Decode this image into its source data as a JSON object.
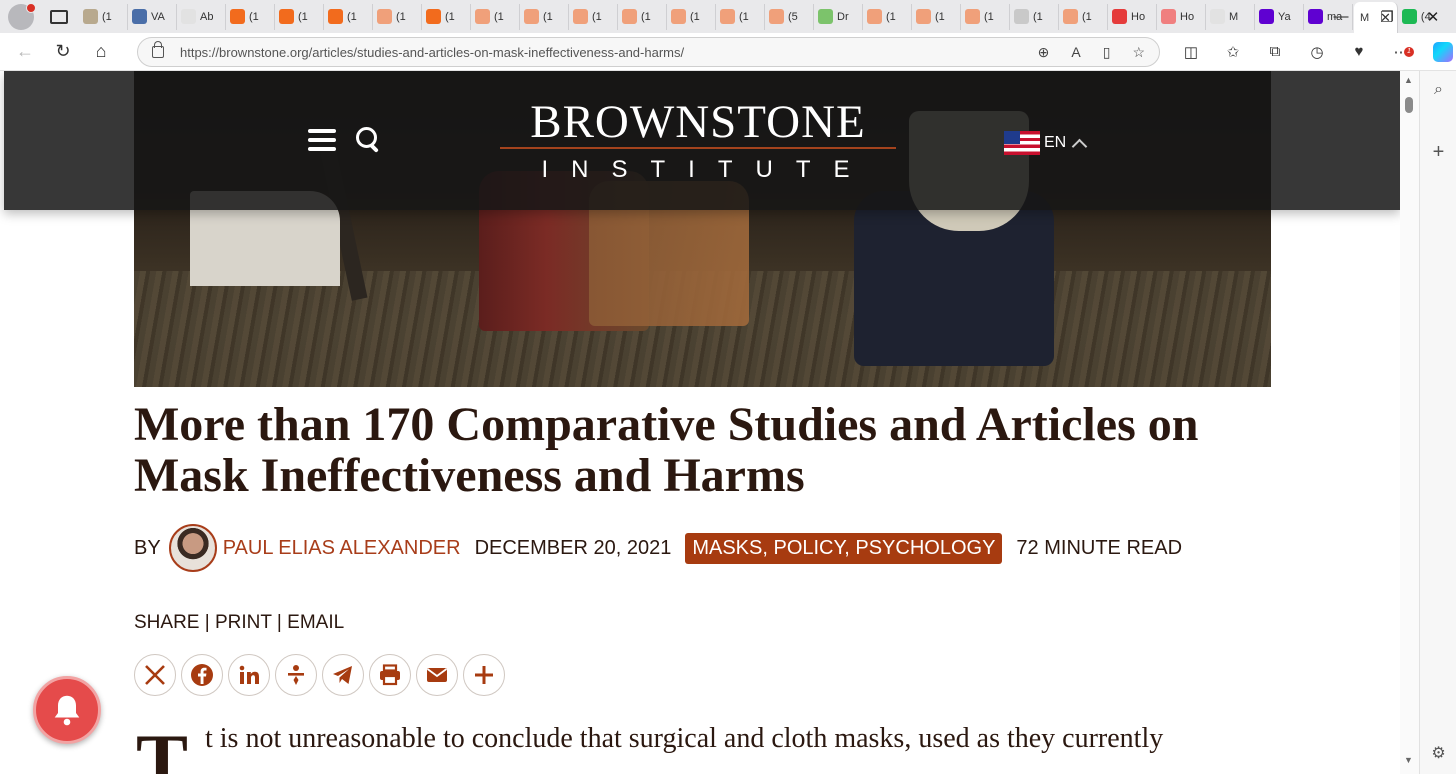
{
  "browser": {
    "tabs": [
      {
        "label": "(1",
        "color": "#b8a98e"
      },
      {
        "label": "VA",
        "color": "#4a6ea8"
      },
      {
        "label": "Ab",
        "color": "#e2e2e2"
      },
      {
        "label": "(1",
        "color": "#f26b1d"
      },
      {
        "label": "(1",
        "color": "#f26b1d"
      },
      {
        "label": "(1",
        "color": "#f26b1d"
      },
      {
        "label": "(1",
        "color": "#f0a07a"
      },
      {
        "label": "(1",
        "color": "#f26b1d"
      },
      {
        "label": "(1",
        "color": "#f0a07a"
      },
      {
        "label": "(1",
        "color": "#f0a07a"
      },
      {
        "label": "(1",
        "color": "#f0a07a"
      },
      {
        "label": "(1",
        "color": "#f0a07a"
      },
      {
        "label": "(1",
        "color": "#f0a07a"
      },
      {
        "label": "(1",
        "color": "#f0a07a"
      },
      {
        "label": "(5",
        "color": "#f0a07a"
      },
      {
        "label": "Dr",
        "color": "#7cc36b"
      },
      {
        "label": "(1",
        "color": "#f0a07a"
      },
      {
        "label": "(1",
        "color": "#f0a07a"
      },
      {
        "label": "(1",
        "color": "#f0a07a"
      },
      {
        "label": "(1",
        "color": "#c9c9c9"
      },
      {
        "label": "(1",
        "color": "#f0a07a"
      },
      {
        "label": "Ho",
        "color": "#e53b3b"
      },
      {
        "label": "Ho",
        "color": "#f07f7f"
      },
      {
        "label": "M",
        "color": "#e2e2e2"
      },
      {
        "label": "Ya",
        "color": "#5f01d1"
      },
      {
        "label": "ma",
        "color": "#5f01d1"
      }
    ],
    "active_tab_label": "M",
    "trailing_tab_label": "(4",
    "url_host": "https://brownstone.org",
    "url_path": "/articles/studies-and-articles-on-mask-ineffectiveness-and-harms/",
    "notification_badge": "1"
  },
  "site": {
    "logo_line1": "BROWNSTONE",
    "logo_line2": "INSTITUTE",
    "language": "EN",
    "accent_color": "#a73b10"
  },
  "article": {
    "title": "More than 170 Comparative Studies and Articles on Mask Ineffectiveness and Harms",
    "by_label": "BY",
    "author": "PAUL ELIAS ALEXANDER",
    "date": "DECEMBER 20, 2021",
    "tags": "MASKS, POLICY, PSYCHOLOGY",
    "read_time": "72 MINUTE READ",
    "share": {
      "share": "SHARE",
      "sep1": " | ",
      "print": "PRINT",
      "sep2": " | ",
      "email": "EMAIL"
    },
    "social_buttons": [
      "x-icon",
      "facebook-icon",
      "linkedin-icon",
      "gettr-icon",
      "telegram-icon",
      "print-icon",
      "email-icon",
      "more-icon"
    ],
    "drop_cap": "T",
    "first_line": "t is not unreasonable to conclude that surgical and cloth masks, used as they currently"
  }
}
